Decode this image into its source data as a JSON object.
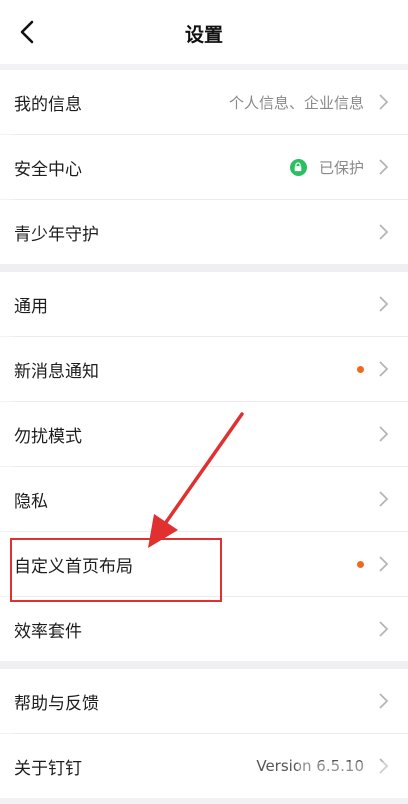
{
  "header": {
    "title": "设置"
  },
  "groups": [
    {
      "items": [
        {
          "label": "我的信息",
          "value": "个人信息、企业信息"
        },
        {
          "label": "安全中心",
          "value": "已保护"
        },
        {
          "label": "青少年守护"
        }
      ]
    },
    {
      "items": [
        {
          "label": "通用"
        },
        {
          "label": "新消息通知"
        },
        {
          "label": "勿扰模式"
        },
        {
          "label": "隐私"
        },
        {
          "label": "自定义首页布局"
        },
        {
          "label": "效率套件"
        }
      ]
    },
    {
      "items": [
        {
          "label": "帮助与反馈"
        },
        {
          "label": "关于钉钉",
          "value": "Version 6.5.10"
        }
      ]
    }
  ],
  "colors": {
    "accent_dot": "#f06a1d",
    "lock_green": "#2bbf5f",
    "annotation_red": "#e0302f"
  },
  "icons": [
    "back-arrow-icon",
    "chevron-right-icon",
    "lock-icon",
    "notification-dot"
  ]
}
